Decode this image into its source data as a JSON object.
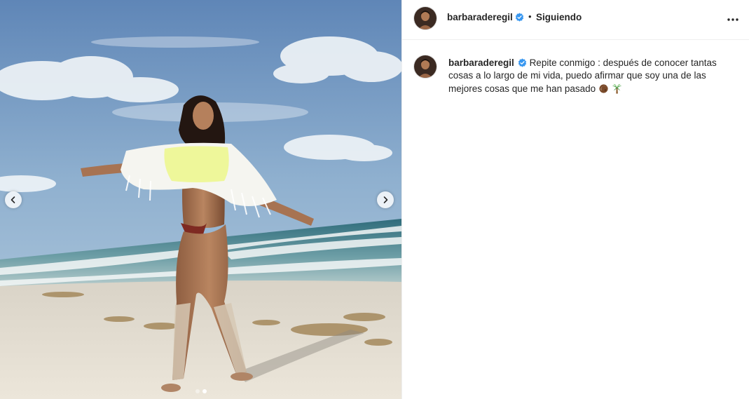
{
  "post": {
    "username": "barbaraderegil",
    "separator": "•",
    "follow_status": "Siguiendo",
    "caption_text": "Repite conmigo : después de conocer tantas cosas a lo largo de mi vida, puedo afirmar que soy una de las mejores cosas que me han pasado",
    "caption_emojis": [
      "coconut-emoji",
      "palm-tree-emoji"
    ]
  },
  "media": {
    "icons": {
      "prev": "chevron-left-icon",
      "next": "chevron-right-icon"
    },
    "carousel_dots": 2,
    "active_dot": 1
  },
  "header": {
    "more_icon": "more-options-icon",
    "verified_icon": "verified-badge-icon"
  },
  "colors": {
    "verified": "#3897f0",
    "text": "#262626",
    "border": "#efefef"
  }
}
